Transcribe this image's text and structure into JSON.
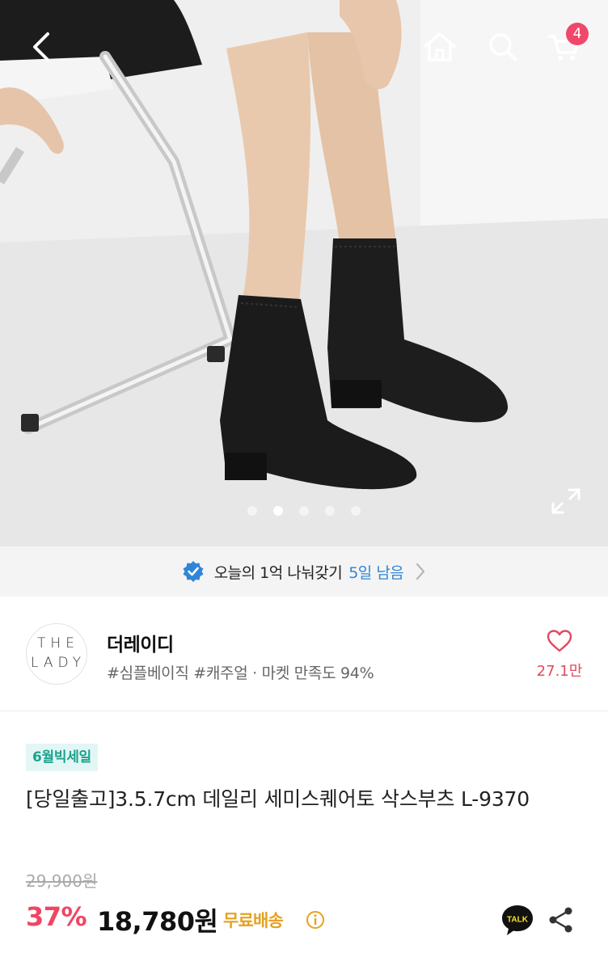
{
  "header": {
    "back_icon": "chevron-left-icon",
    "home_icon": "home-icon",
    "search_icon": "search-icon",
    "cart_icon": "cart-icon",
    "cart_count": "4"
  },
  "carousel": {
    "total_images": 5,
    "active_index": 1,
    "expand_icon": "expand-icon"
  },
  "promo": {
    "check_icon": "verified-check-icon",
    "text": "오늘의 1억 나눠갖기",
    "days_left": "5일 남음",
    "chevron_icon": "chevron-right-icon"
  },
  "store": {
    "logo_line1": "THE",
    "logo_line2": "LADY",
    "name": "더레이디",
    "tags": "#심플베이직 #캐주얼 · 마켓 만족도 94%",
    "favorite_icon": "heart-outline-icon",
    "favorite_count": "27.1만"
  },
  "product": {
    "sale_badge": "6월빅세일",
    "title": "[당일출고]3.5.7cm 데일리 세미스퀘어토 삭스부츠 L-9370",
    "original_price": "29,900원",
    "discount_rate": "37%",
    "price": "18,780원",
    "shipping": "무료배송",
    "talk_label": "TALK",
    "share_icon": "share-icon"
  },
  "colors": {
    "accent_red": "#ef4663",
    "badge_red": "#f0486a",
    "promo_blue": "#2f86d8",
    "shipping_gold": "#e6a11f",
    "sale_green": "#1aa38d",
    "talk_yellow": "#f7e02a"
  }
}
